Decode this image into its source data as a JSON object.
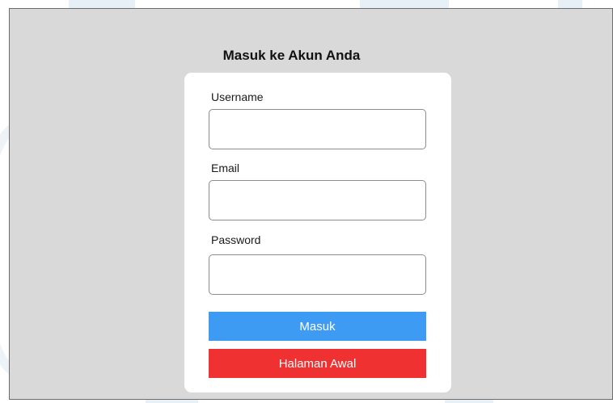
{
  "login": {
    "title": "Masuk ke Akun Anda",
    "fields": {
      "username": {
        "label": "Username",
        "value": "",
        "placeholder": ""
      },
      "email": {
        "label": "Email",
        "value": "",
        "placeholder": ""
      },
      "password": {
        "label": "Password",
        "value": "",
        "placeholder": ""
      }
    },
    "buttons": {
      "submit_label": "Masuk",
      "home_label": "Halaman Awal"
    }
  },
  "colors": {
    "background": "#d9d9d9",
    "card": "#ffffff",
    "primary_button": "#3d9bf3",
    "danger_button": "#f03131"
  }
}
